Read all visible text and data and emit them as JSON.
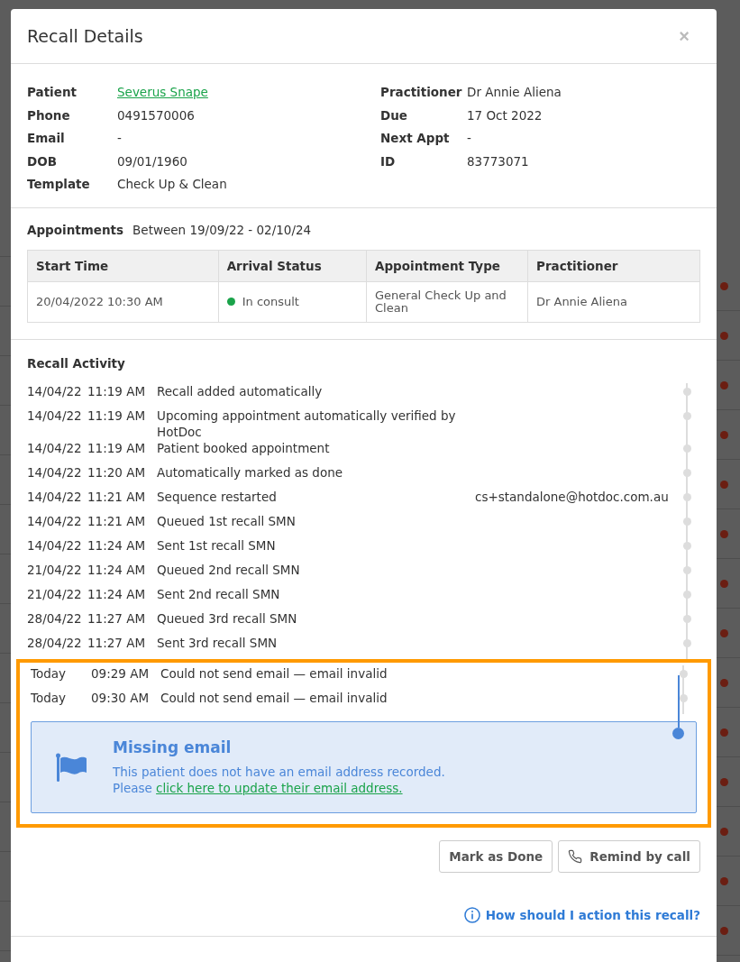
{
  "modal": {
    "title": "Recall Details",
    "close": "×"
  },
  "details_left": [
    {
      "label": "Patient",
      "value": "Severus Snape",
      "kind": "link"
    },
    {
      "label": "Phone",
      "value": "0491570006",
      "kind": "text"
    },
    {
      "label": "Email",
      "value": "-",
      "kind": "text"
    },
    {
      "label": "DOB",
      "value": "09/01/1960",
      "kind": "text"
    },
    {
      "label": "Template",
      "value": "Check Up & Clean",
      "kind": "text"
    }
  ],
  "details_right": [
    {
      "label": "Practitioner",
      "value": "Dr Annie Aliena",
      "kind": "text"
    },
    {
      "label": "Due",
      "value": "17 Oct 2022",
      "kind": "text"
    },
    {
      "label": "Next Appt",
      "value": "-",
      "kind": "text"
    },
    {
      "label": "ID",
      "value": "83773071",
      "kind": "text"
    }
  ],
  "appointments": {
    "label": "Appointments",
    "range": "Between 19/09/22 - 02/10/24",
    "columns": [
      "Start Time",
      "Arrival Status",
      "Appointment Type",
      "Practitioner"
    ],
    "rows": [
      {
        "start": "20/04/2022 10:30 AM",
        "status": "In consult",
        "color": "#1aa34a",
        "type": "General Check Up and Clean",
        "practitioner": "Dr Annie Aliena"
      }
    ]
  },
  "activity_title": "Recall Activity",
  "activity": [
    {
      "date": "14/04/22",
      "time": "11:19 AM",
      "text": "Recall added automatically",
      "highlighted": false
    },
    {
      "date": "14/04/22",
      "time": "11:19 AM",
      "text": "Upcoming appointment automatically verified by HotDoc",
      "highlighted": false
    },
    {
      "date": "14/04/22",
      "time": "11:19 AM",
      "text": "Patient booked appointment",
      "highlighted": false
    },
    {
      "date": "14/04/22",
      "time": "11:20 AM",
      "text": "Automatically marked as done",
      "highlighted": false
    },
    {
      "date": "14/04/22",
      "time": "11:21 AM",
      "text": "Sequence restarted",
      "user": "cs+standalone@hotdoc.com.au",
      "highlighted": false
    },
    {
      "date": "14/04/22",
      "time": "11:21 AM",
      "text": "Queued 1st recall SMN",
      "highlighted": false
    },
    {
      "date": "14/04/22",
      "time": "11:24 AM",
      "text": "Sent 1st recall SMN",
      "highlighted": false
    },
    {
      "date": "21/04/22",
      "time": "11:24 AM",
      "text": "Queued 2nd recall SMN",
      "highlighted": false
    },
    {
      "date": "21/04/22",
      "time": "11:24 AM",
      "text": "Sent 2nd recall SMN",
      "highlighted": false
    },
    {
      "date": "28/04/22",
      "time": "11:27 AM",
      "text": "Queued 3rd recall SMN",
      "highlighted": false
    },
    {
      "date": "28/04/22",
      "time": "11:27 AM",
      "text": "Sent 3rd recall SMN",
      "highlighted": false
    },
    {
      "date": "Today",
      "time": "09:29 AM",
      "text": "Could not send email — email invalid",
      "highlighted": true
    },
    {
      "date": "Today",
      "time": "09:30 AM",
      "text": "Could not send email — email invalid",
      "highlighted": true
    }
  ],
  "alert": {
    "title": "Missing email",
    "message": "This patient does not have an email address recorded.",
    "prefix": "Please",
    "link": "click here to update their email address.",
    "highlighted": true
  },
  "buttons": [
    "Mark as Done",
    "Remind by call"
  ],
  "help_link": "How should I action this recall?"
}
